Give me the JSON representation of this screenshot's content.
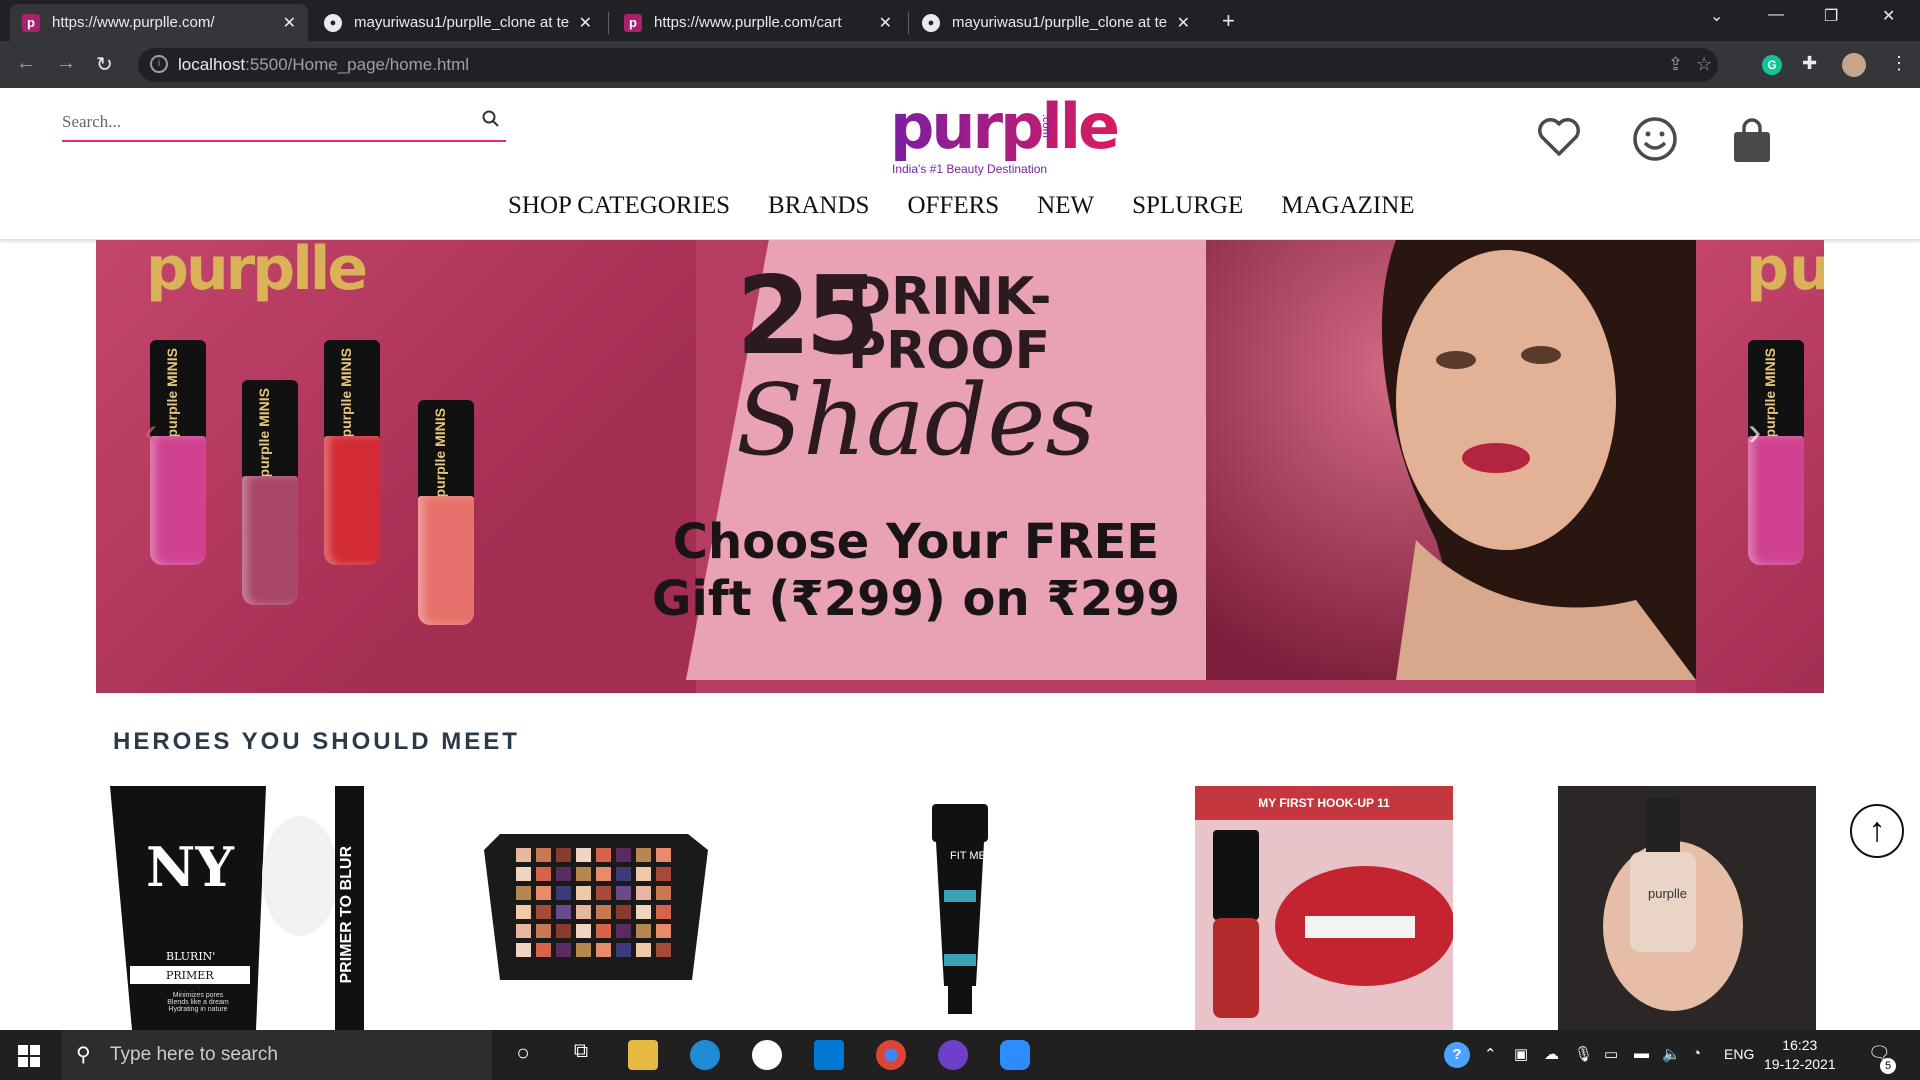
{
  "browser": {
    "tabs": [
      {
        "title": "https://www.purplle.com/",
        "favicon": "purplle-icon",
        "active": true
      },
      {
        "title": "mayuriwasu1/purplle_clone at te",
        "favicon": "github-icon",
        "active": false
      },
      {
        "title": "https://www.purplle.com/cart",
        "favicon": "purplle-icon",
        "active": false
      },
      {
        "title": "mayuriwasu1/purplle_clone at te",
        "favicon": "github-icon",
        "active": false
      }
    ],
    "url_host": "localhost",
    "url_rest": ":5500/Home_page/home.html"
  },
  "header": {
    "search_placeholder": "Search...",
    "logo_text": "purplle",
    "logo_com": ".com",
    "logo_tagline": "India's #1 Beauty Destination",
    "nav": [
      "SHOP CATEGORIES",
      "BRANDS",
      "OFFERS",
      "NEW",
      "SPLURGE",
      "MAGAZINE"
    ]
  },
  "banner": {
    "brand": "purplle",
    "number": "25",
    "line1": "DRINK-",
    "line2": "PROOF",
    "script": "Shades",
    "gift_line1": "Choose Your FREE",
    "gift_line2": "Gift (₹299) on ₹299",
    "bottle_label": "purplle MINIS",
    "bottle_colors": [
      "#d0428f",
      "#a8476a",
      "#d32b34",
      "#e8716c"
    ]
  },
  "heroes": {
    "title": "HEROES YOU SHOULD MEET",
    "products": [
      {
        "name": "ny-bae-primer",
        "side_text": "PRIMER TO BLUR",
        "label1": "BLURIN'",
        "label2": "PRIMER",
        "label3": "Minimizes pores\nBlends like a dream\nHydrating in nature"
      },
      {
        "name": "eyeshadow-palette"
      },
      {
        "name": "fit-me-concealer",
        "label": "FIT ME"
      },
      {
        "name": "lip-color",
        "banner": "MY FIRST HOOK-UP 11"
      },
      {
        "name": "nail-lacquer",
        "label": "purplle"
      }
    ]
  },
  "taskbar": {
    "search_placeholder": "Type here to search",
    "lang": "ENG",
    "time": "16:23",
    "date": "19-12-2021",
    "notif_count": "5"
  },
  "colors": {
    "accent": "#e6287e",
    "brand_purple": "#7b1fa2",
    "banner_pink": "#e9a2b3"
  }
}
